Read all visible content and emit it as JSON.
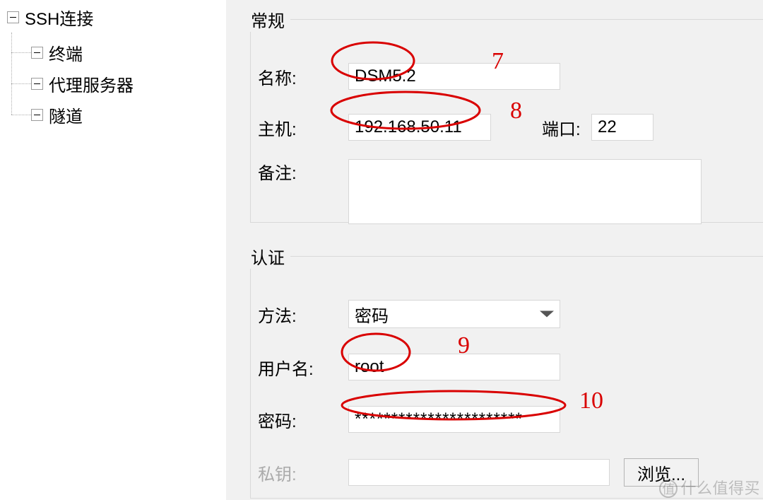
{
  "tree": {
    "root": "SSH连接",
    "children": [
      "终端",
      "代理服务器",
      "隧道"
    ]
  },
  "groups": {
    "general": {
      "title": "常规",
      "fields": {
        "name_label": "名称:",
        "name_value": "DSM5.2",
        "host_label": "主机:",
        "host_value": "192.168.50.11",
        "port_label": "端口:",
        "port_value": "22",
        "note_label": "备注:",
        "note_value": ""
      }
    },
    "auth": {
      "title": "认证",
      "fields": {
        "method_label": "方法:",
        "method_value": "密码",
        "user_label": "用户名:",
        "user_value": "root",
        "pass_label": "密码:",
        "pass_value": "***********************",
        "key_label": "私钥:",
        "key_value": "",
        "browse_label": "浏览..."
      }
    }
  },
  "annotations": {
    "a7": "7",
    "a8": "8",
    "a9": "9",
    "a10": "10"
  },
  "watermark": "什么值得买"
}
